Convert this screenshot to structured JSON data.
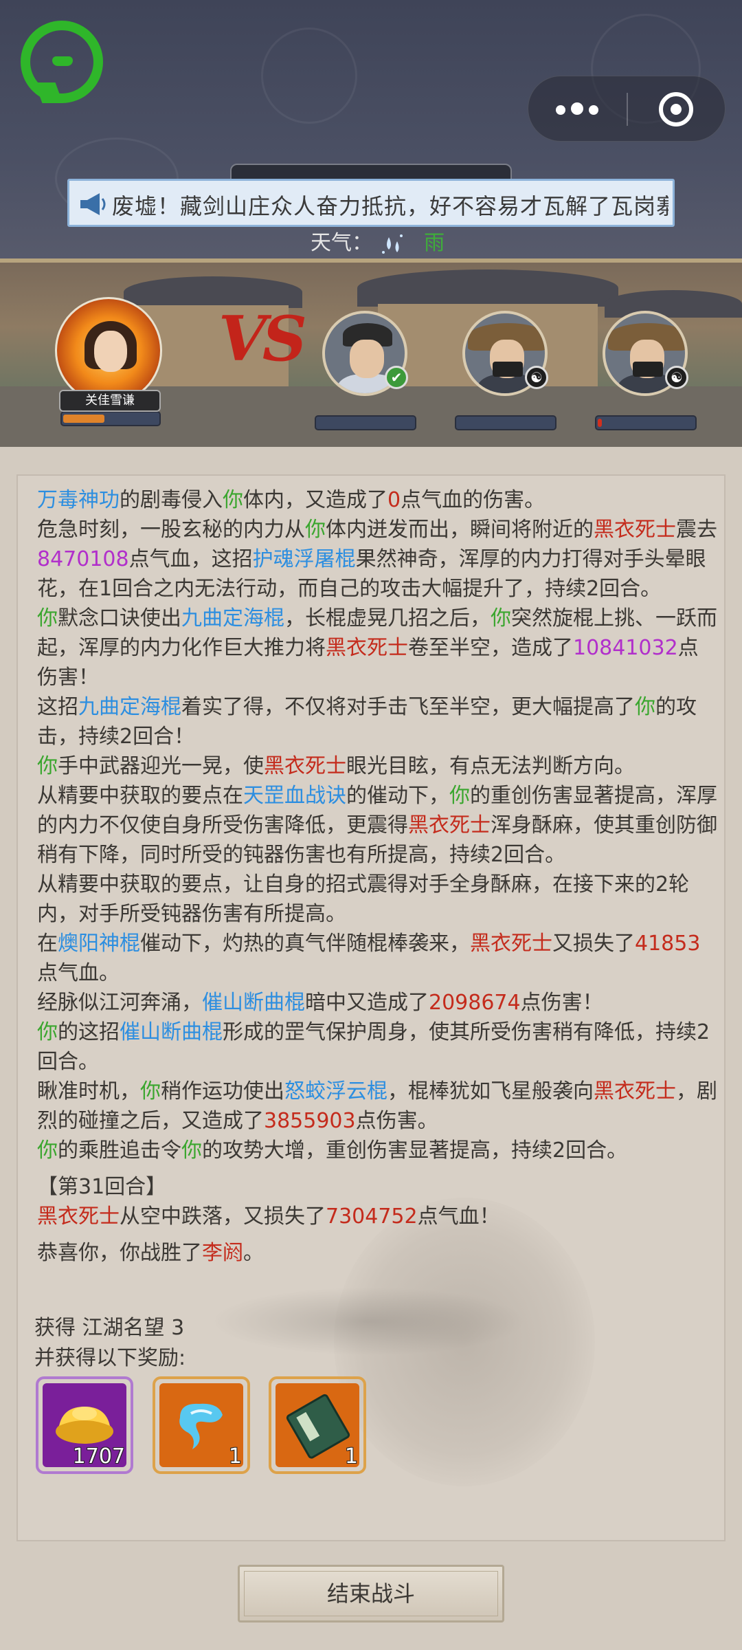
{
  "header": {
    "news_ticker": "废墟！藏剑山庄众人奋力抵抗，好不容易才瓦解了瓦岗寨的",
    "weather_label": "天气：",
    "weather_value": "雨"
  },
  "battle": {
    "player_name": "关佳雪谦",
    "vs_text": "VS",
    "enemy_badges": [
      "✔",
      "☯",
      "☯"
    ],
    "enemy_hp": [
      0.0,
      0.0,
      0.03
    ]
  },
  "log": [
    [
      {
        "t": "万毒神功",
        "c": "blue"
      },
      {
        "t": "的剧毒侵入"
      },
      {
        "t": "你",
        "c": "green"
      },
      {
        "t": "体内，又造成了"
      },
      {
        "t": "0",
        "c": "red"
      },
      {
        "t": "点气血的伤害。"
      }
    ],
    [
      {
        "t": "危急时刻，一股玄秘的内力从"
      },
      {
        "t": "你",
        "c": "green"
      },
      {
        "t": "体内迸发而出，瞬间将附近的"
      },
      {
        "t": "黑衣死士",
        "c": "red"
      },
      {
        "t": "震去"
      },
      {
        "t": "8470108",
        "c": "purple"
      },
      {
        "t": "点气血，这招"
      },
      {
        "t": "护魂浮屠棍",
        "c": "blue"
      },
      {
        "t": "果然神奇，浑厚的内力打得对手头晕眼花，在1回合之内无法行动，而自己的攻击大幅提升了，持续2回合。"
      }
    ],
    [
      {
        "t": "你",
        "c": "green"
      },
      {
        "t": "默念口诀使出"
      },
      {
        "t": "九曲定海棍",
        "c": "blue"
      },
      {
        "t": "，长棍虚晃几招之后，"
      },
      {
        "t": "你",
        "c": "green"
      },
      {
        "t": "突然旋棍上挑、一跃而起，浑厚的内力化作巨大推力将"
      },
      {
        "t": "黑衣死士",
        "c": "red"
      },
      {
        "t": "卷至半空，造成了"
      },
      {
        "t": "10841032",
        "c": "purple"
      },
      {
        "t": "点伤害！"
      }
    ],
    [
      {
        "t": "这招"
      },
      {
        "t": "九曲定海棍",
        "c": "blue"
      },
      {
        "t": "着实了得，不仅将对手击飞至半空，更大幅提高了"
      },
      {
        "t": "你",
        "c": "green"
      },
      {
        "t": "的攻击，持续2回合！"
      }
    ],
    [
      {
        "t": "你",
        "c": "green"
      },
      {
        "t": "手中武器迎光一晃，使"
      },
      {
        "t": "黑衣死士",
        "c": "red"
      },
      {
        "t": "眼光目眩，有点无法判断方向。"
      }
    ],
    [
      {
        "t": "从精要中获取的要点在"
      },
      {
        "t": "天罡血战诀",
        "c": "blue"
      },
      {
        "t": "的催动下，"
      },
      {
        "t": "你",
        "c": "green"
      },
      {
        "t": "的重创伤害显著提高，浑厚的内力不仅使自身所受伤害降低，更震得"
      },
      {
        "t": "黑衣死士",
        "c": "red"
      },
      {
        "t": "浑身酥麻，使其重创防御稍有下降，同时所受的钝器伤害也有所提高，持续2回合。"
      }
    ],
    [
      {
        "t": "从精要中获取的要点，让自身的招式震得对手全身酥麻，在接下来的2轮内，对手所受钝器伤害有所提高。"
      }
    ],
    [
      {
        "t": "在"
      },
      {
        "t": "燠阳神棍",
        "c": "blue"
      },
      {
        "t": "催动下，灼热的真气伴随棍棒袭来，"
      },
      {
        "t": "黑衣死士",
        "c": "red"
      },
      {
        "t": "又损失了"
      },
      {
        "t": "41853",
        "c": "red"
      },
      {
        "t": "点气血。"
      }
    ],
    [
      {
        "t": "经脉似江河奔涌，"
      },
      {
        "t": "催山断曲棍",
        "c": "blue"
      },
      {
        "t": "暗中又造成了"
      },
      {
        "t": "2098674",
        "c": "red"
      },
      {
        "t": "点伤害！"
      }
    ],
    [
      {
        "t": "你",
        "c": "green"
      },
      {
        "t": "的这招"
      },
      {
        "t": "催山断曲棍",
        "c": "blue"
      },
      {
        "t": "形成的罡气保护周身，使其所受伤害稍有降低，持续2回合。"
      }
    ],
    [
      {
        "t": "瞅准时机，"
      },
      {
        "t": "你",
        "c": "green"
      },
      {
        "t": "稍作运功使出"
      },
      {
        "t": "怒蛟浮云棍",
        "c": "blue"
      },
      {
        "t": "，棍棒犹如飞星般袭向"
      },
      {
        "t": "黑衣死士",
        "c": "red"
      },
      {
        "t": "，剧烈的碰撞之后，又造成了"
      },
      {
        "t": "3855903",
        "c": "red"
      },
      {
        "t": "点伤害。"
      }
    ],
    [
      {
        "t": "你",
        "c": "green"
      },
      {
        "t": "的乘胜追击令"
      },
      {
        "t": "你",
        "c": "green"
      },
      {
        "t": "的攻势大增，重创伤害显著提高，持续2回合。"
      }
    ],
    [
      {
        "t": "【第31回合】"
      }
    ],
    [
      {
        "t": "黑衣死士",
        "c": "red"
      },
      {
        "t": "从空中跌落，又损失了"
      },
      {
        "t": "7304752",
        "c": "red"
      },
      {
        "t": "点气血！"
      }
    ],
    [
      {
        "t": "恭喜你，你战胜了"
      },
      {
        "t": "李阏",
        "c": "red"
      },
      {
        "t": "。"
      }
    ]
  ],
  "rewards": {
    "line1_prefix": "获得 ",
    "line1_value": "江湖名望 3",
    "line2": "并获得以下奖励:",
    "items": [
      {
        "name": "gold-ingot",
        "count": "1707"
      },
      {
        "name": "blue-cloud-item",
        "count": "1"
      },
      {
        "name": "green-manual-book",
        "count": "1"
      }
    ]
  },
  "footer": {
    "end_button": "结束战斗"
  }
}
